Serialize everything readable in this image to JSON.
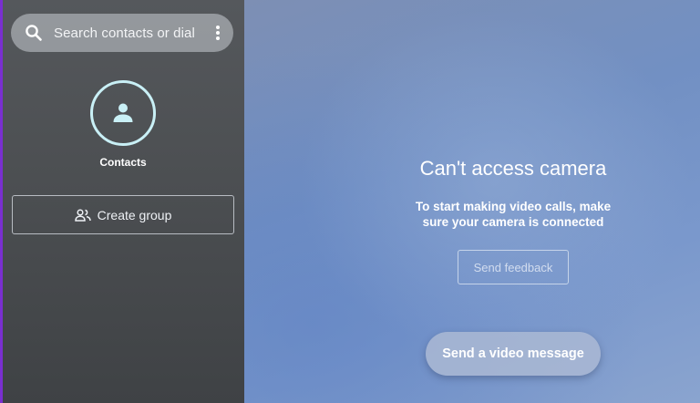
{
  "sidebar": {
    "search": {
      "placeholder": "Search contacts or dial",
      "icon": "search-icon",
      "more_icon": "more-vert-icon"
    },
    "contacts": {
      "label": "Contacts",
      "icon": "person-icon",
      "ring_color": "#c9f0f6"
    },
    "create_group": {
      "label": "Create group",
      "icon": "people-icon"
    }
  },
  "main": {
    "title": "Can't access camera",
    "subtitle_line1": "To start making video calls, make",
    "subtitle_line2": "sure your camera is connected",
    "feedback_button": "Send feedback",
    "video_message_button": "Send a video message"
  },
  "colors": {
    "sidebar_bg": "#4d5053",
    "main_bg": "#7290c3",
    "accent_border": "#7a2fd0"
  }
}
